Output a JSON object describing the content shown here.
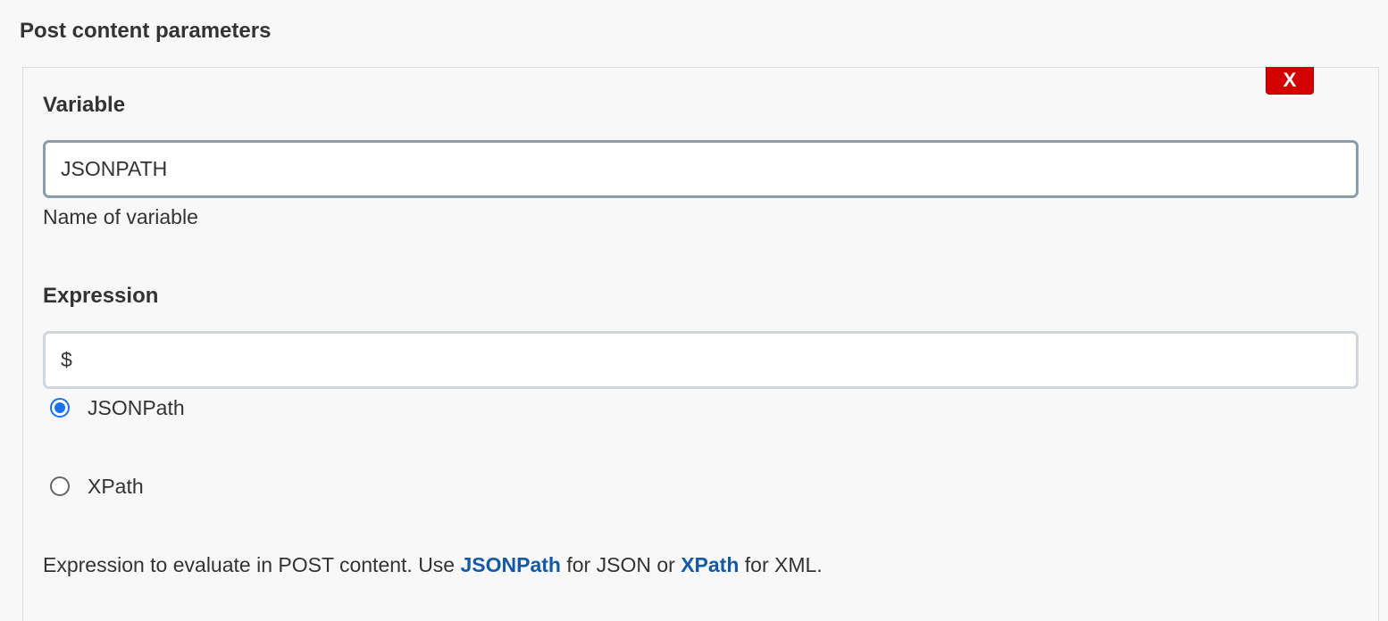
{
  "section": {
    "title": "Post content parameters"
  },
  "delete_button": {
    "label": "X"
  },
  "variable": {
    "label": "Variable",
    "value": "JSONPATH",
    "help": "Name of variable"
  },
  "expression": {
    "label": "Expression",
    "value": "$",
    "options": [
      {
        "label": "JSONPath",
        "selected": true
      },
      {
        "label": "XPath",
        "selected": false
      }
    ],
    "help": {
      "prefix": "Expression to evaluate in POST content. Use ",
      "link1": "JSONPath",
      "middle": " for JSON or ",
      "link2": "XPath",
      "suffix": " for XML."
    }
  },
  "colors": {
    "delete_button": "#d40000",
    "link": "#1459a8",
    "radio_selected": "#1a73e8"
  }
}
